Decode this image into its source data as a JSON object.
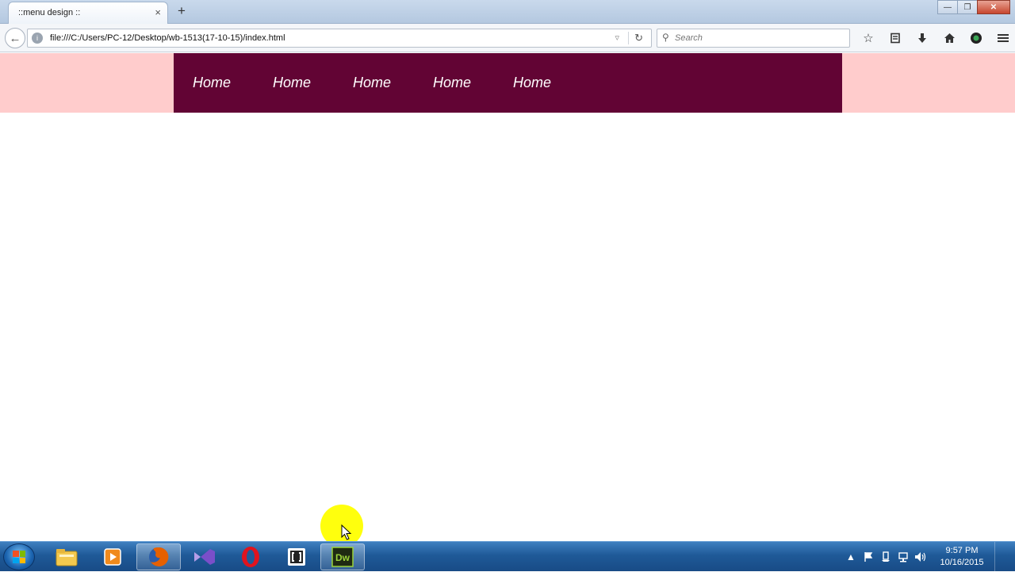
{
  "browser": {
    "tab_title": "::menu design ::",
    "tab_close": "×",
    "new_tab": "+",
    "url": "file:///C:/Users/PC-12/Desktop/wb-1513(17-10-15)/index.html",
    "search_placeholder": "Search",
    "window_controls": {
      "minimize": "—",
      "maximize": "❐",
      "close": "✕"
    }
  },
  "menu": {
    "items": [
      {
        "label": "Home"
      },
      {
        "label": "Home"
      },
      {
        "label": "Home"
      },
      {
        "label": "Home"
      },
      {
        "label": "Home"
      }
    ],
    "band_color": "#ffcccc",
    "menu_color": "#620434"
  },
  "taskbar": {
    "apps": [
      {
        "name": "file-explorer-icon",
        "active": false
      },
      {
        "name": "media-player-icon",
        "active": false
      },
      {
        "name": "firefox-icon",
        "active": true
      },
      {
        "name": "visual-studio-icon",
        "active": false
      },
      {
        "name": "opera-icon",
        "active": false
      },
      {
        "name": "app-bracket-icon",
        "active": false
      },
      {
        "name": "dreamweaver-icon",
        "active": true
      }
    ],
    "dreamweaver_label": "Dw",
    "clock_time": "9:57 PM",
    "clock_date": "10/16/2015"
  }
}
